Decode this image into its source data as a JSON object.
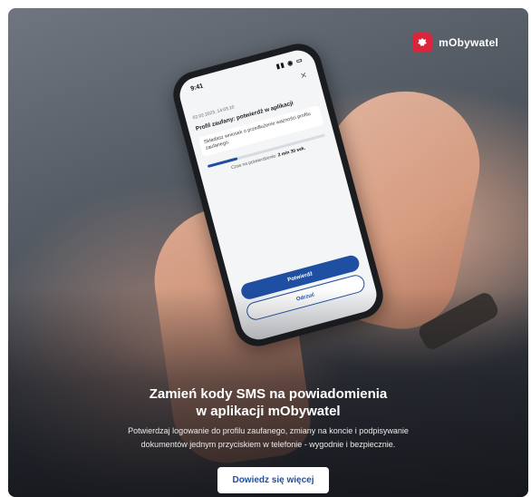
{
  "brand": {
    "name": "mObywatel",
    "icon": "poland-eagle-icon",
    "color": "#d9263a"
  },
  "phone": {
    "time": "9:41",
    "status_icons": "▮▮ ◉ ▭",
    "close_symbol": "✕",
    "timestamp": "02.02.2023, 14:03:10",
    "request_title": "Profil zaufany: potwierdź w aplikacji",
    "request_desc": "Składasz wniosek o przedłużenie ważności profilu zaufanego.",
    "progress_fraction": 0.25,
    "timer_label": "Czas na potwierdzenie:",
    "timer_value": "2 min 30 sek.",
    "confirm_label": "Potwierdź",
    "reject_label": "Odrzuć"
  },
  "banner": {
    "headline_line1": "Zamień kody SMS na powiadomienia",
    "headline_line2": "w aplikacji mObywatel",
    "body_line1": "Potwierdzaj logowanie do profilu zaufanego, zmiany na koncie i podpisywanie",
    "body_line2": "dokumentów jednym przyciskiem w telefonie - wygodnie i bezpiecznie.",
    "cta_label": "Dowiedz się więcej"
  },
  "colors": {
    "accent": "#1f4fa3",
    "brand": "#d9263a"
  }
}
